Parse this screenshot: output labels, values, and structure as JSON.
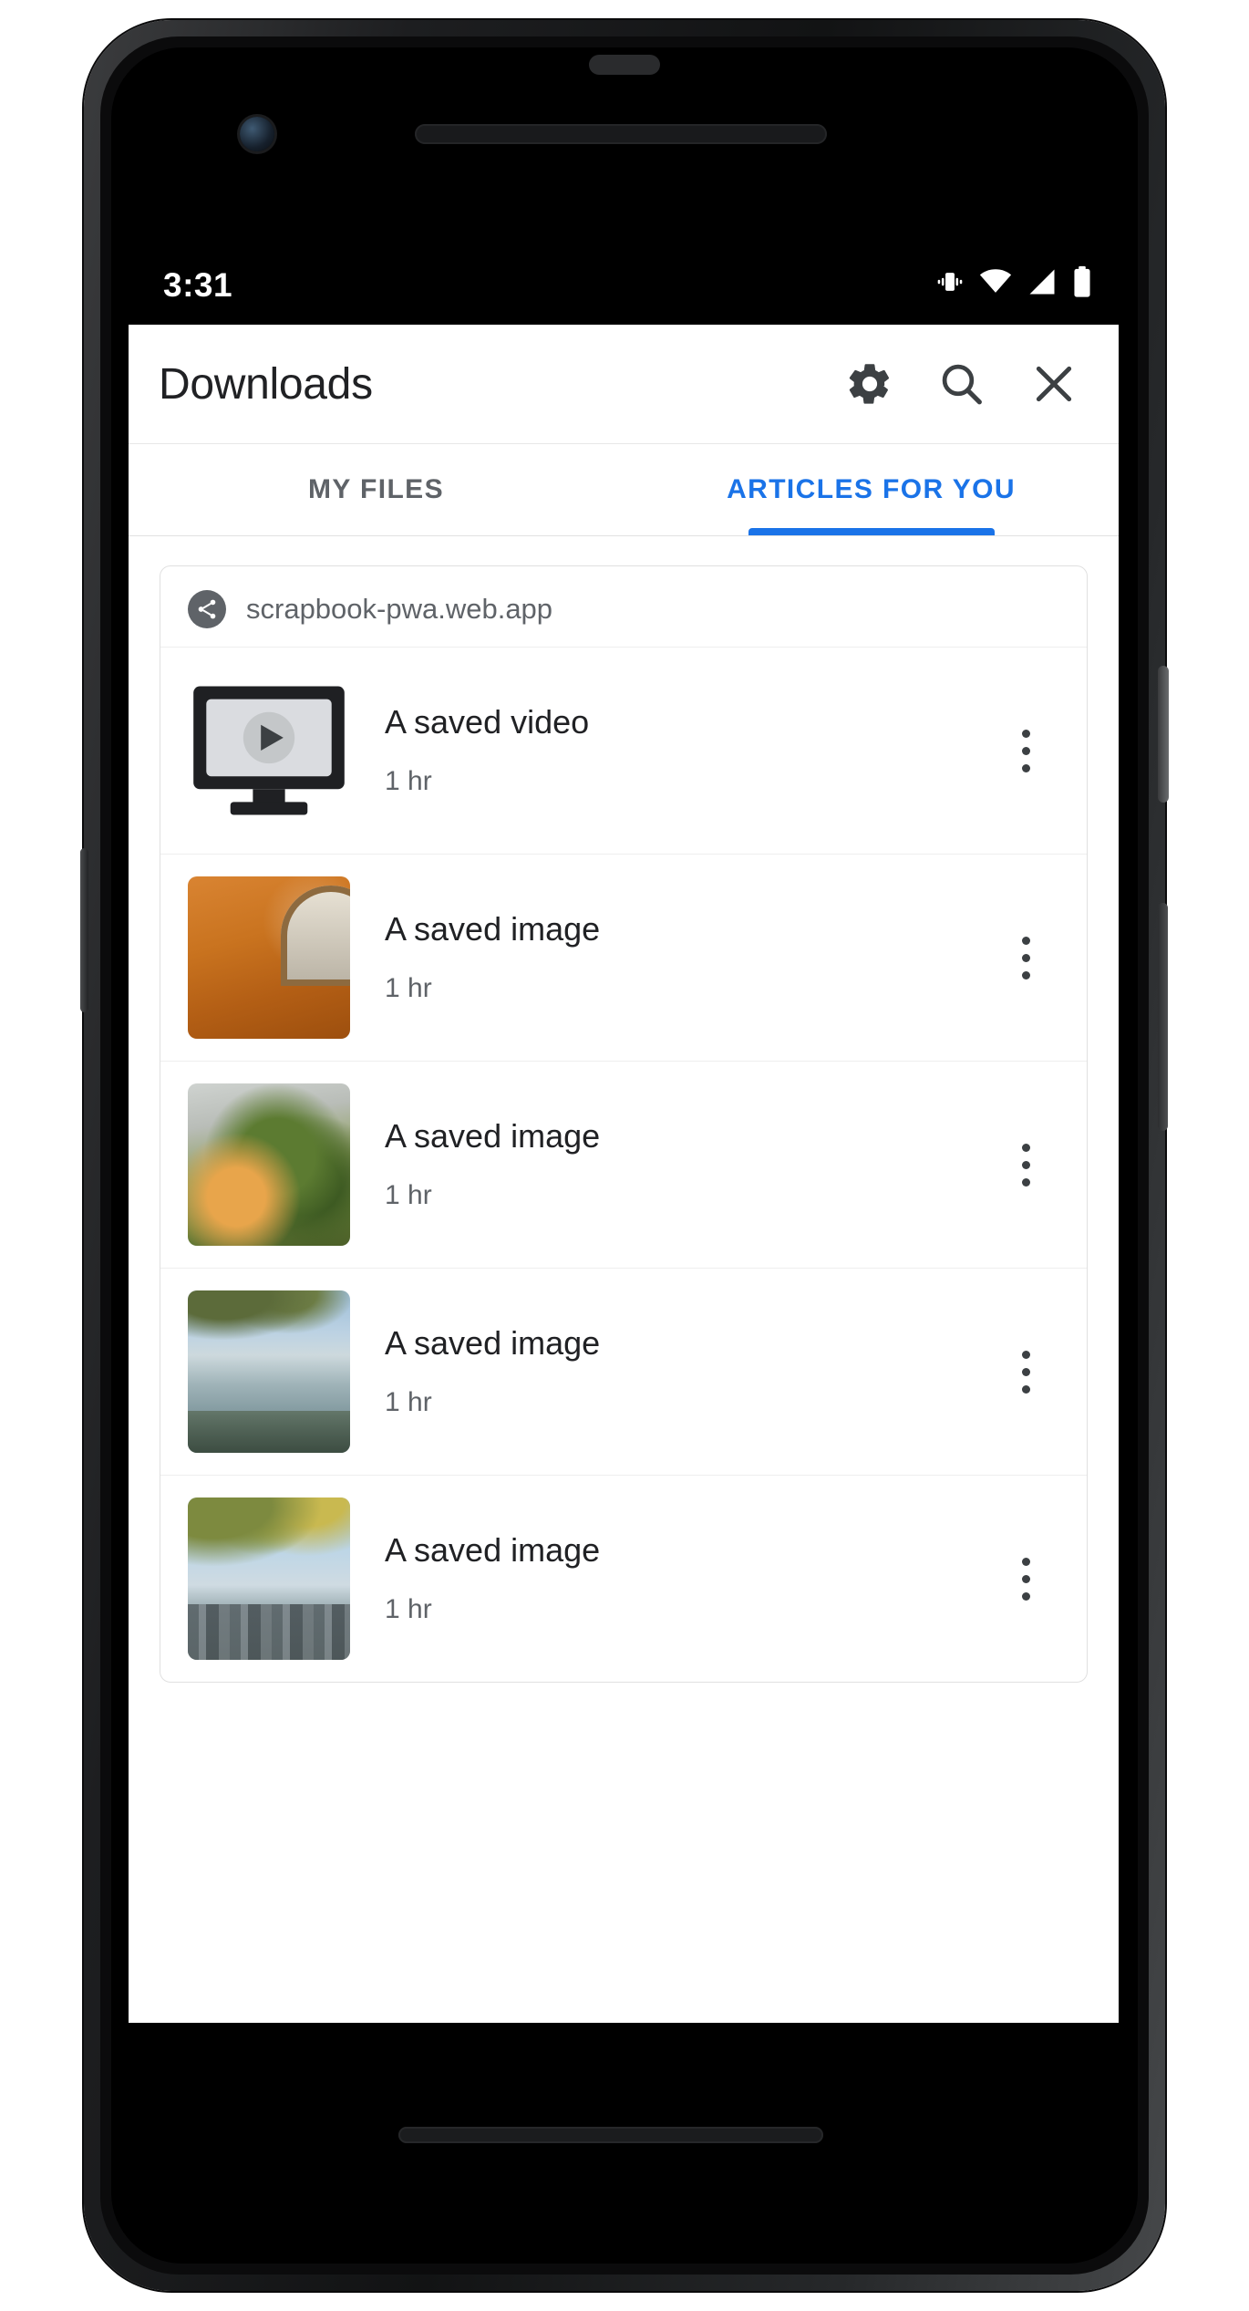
{
  "status_bar": {
    "time": "3:31",
    "icons": [
      "vibrate-icon",
      "wifi-icon",
      "signal-icon",
      "battery-icon"
    ]
  },
  "app_bar": {
    "title": "Downloads",
    "actions": [
      {
        "name": "settings-button",
        "icon": "gear-icon"
      },
      {
        "name": "search-button",
        "icon": "search-icon"
      },
      {
        "name": "close-button",
        "icon": "close-icon"
      }
    ]
  },
  "tabs": [
    {
      "label": "MY FILES",
      "active": false
    },
    {
      "label": "ARTICLES FOR YOU",
      "active": true
    }
  ],
  "card": {
    "origin": "scrapbook-pwa.web.app",
    "origin_icon": "share-icon",
    "items": [
      {
        "title": "A saved video",
        "subtitle": "1 hr",
        "thumb": "video-placeholder-icon",
        "menu": "overflow-menu-icon"
      },
      {
        "title": "A saved image",
        "subtitle": "1 hr",
        "thumb": "orange-wall-photo",
        "menu": "overflow-menu-icon"
      },
      {
        "title": "A saved image",
        "subtitle": "1 hr",
        "thumb": "avocado-toast-photo",
        "menu": "overflow-menu-icon"
      },
      {
        "title": "A saved image",
        "subtitle": "1 hr",
        "thumb": "lake-shore-photo",
        "menu": "overflow-menu-icon"
      },
      {
        "title": "A saved image",
        "subtitle": "1 hr",
        "thumb": "city-skyline-photo",
        "menu": "overflow-menu-icon"
      }
    ]
  },
  "colors": {
    "accent": "#1a73e8",
    "primary_text": "#202124",
    "secondary_text": "#5f6368",
    "surface": "#ffffff",
    "divider": "#eeeeee"
  }
}
